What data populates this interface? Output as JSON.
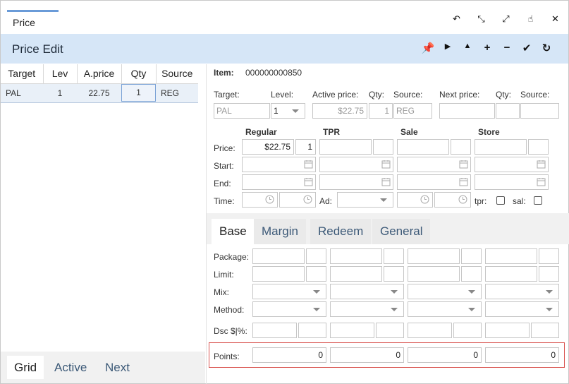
{
  "window": {
    "tab_label": "Price",
    "controls": [
      "undo-icon",
      "shrink-icon",
      "expand-icon",
      "pointer-icon",
      "close-icon"
    ]
  },
  "header": {
    "title": "Price Edit",
    "controls": [
      "pin-icon",
      "play-icon",
      "caret-up-icon",
      "plus-icon",
      "minus-icon",
      "check-icon",
      "refresh-icon"
    ]
  },
  "grid": {
    "columns": [
      "Target",
      "Lev",
      "A.price",
      "Qty",
      "Source"
    ],
    "rows": [
      {
        "target": "PAL",
        "lev": "1",
        "aprice": "22.75",
        "qty": "1",
        "source": "REG"
      }
    ]
  },
  "bottom_tabs": [
    "Grid",
    "Active",
    "Next"
  ],
  "item": {
    "label": "Item:",
    "value": "000000000850"
  },
  "labels": {
    "target": "Target:",
    "level": "Level:",
    "active_price": "Active price:",
    "qty": "Qty:",
    "source": "Source:",
    "next_price": "Next price:",
    "qty2": "Qty:",
    "source2": "Source:",
    "price": "Price:",
    "start": "Start:",
    "end": "End:",
    "time": "Time:",
    "ad": "Ad:",
    "tpr": "tpr:",
    "sal": "sal:",
    "package": "Package:",
    "limit": "Limit:",
    "mix": "Mix:",
    "method": "Method:",
    "dsc": "Dsc $|%:",
    "points": "Points:"
  },
  "values": {
    "target": "PAL",
    "level": "1",
    "active_price": "$22.75",
    "active_qty": "1",
    "source": "REG",
    "regular_price": "$22.75",
    "regular_qty": "1"
  },
  "price_groups": [
    "Regular",
    "TPR",
    "Sale",
    "Store"
  ],
  "sub_tabs": [
    "Base",
    "Margin",
    "Redeem",
    "General"
  ],
  "points": [
    "0",
    "0",
    "0",
    "0"
  ]
}
